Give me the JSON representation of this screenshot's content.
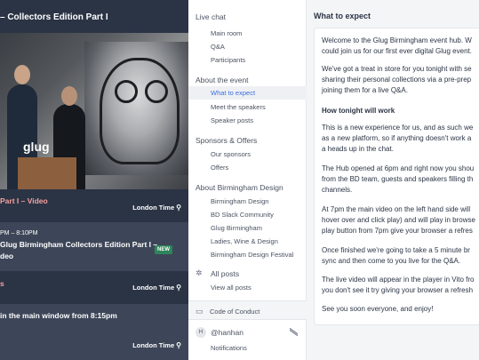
{
  "left": {
    "title": "– Collectors Edition Part I",
    "video_logo": "glug",
    "sessions": [
      {
        "title": "Part I – Video",
        "time": "London Time",
        "title_color": "#f4a0a0"
      },
      {
        "time_range": "PM – 8:10PM",
        "title_lines": [
          "Glug Birmingham Collectors Edition Part I –",
          "deo"
        ],
        "badge": "NEW",
        "time": "London Time"
      },
      {
        "title": "s",
        "time": "London Time",
        "title_color": "#f4a0a0"
      },
      {
        "title": "in the main window from 8:15pm",
        "time": "London Time"
      }
    ]
  },
  "nav": {
    "sections": [
      {
        "label": "Live chat",
        "items": [
          "Main room",
          "Q&A",
          "Participants"
        ]
      },
      {
        "label": "About the event",
        "items": [
          "What to expect",
          "Meet the speakers",
          "Speaker posts"
        ],
        "selected": 0
      },
      {
        "label": "Sponsors & Offers",
        "items": [
          "Our sponsors",
          "Offers"
        ]
      },
      {
        "label": "About Birmingham Design",
        "items": [
          "Birmingham Design",
          "BD Slack Community",
          "Glug Birmingham",
          "Ladies, Wine & Design",
          "Birmingham Design Festival"
        ]
      }
    ],
    "all_posts": "All posts",
    "view_all_posts": "View all posts",
    "code_of_conduct": "Code of Conduct",
    "user": {
      "initial": "H",
      "handle": "@hanhan"
    },
    "notifications": "Notifications",
    "accent": "#3c6ee0"
  },
  "right": {
    "header": "What to expect",
    "paragraphs": [
      {
        "lines": [
          "Welcome to the Glug Birmingham event hub. W",
          "could join us for our first ever digital Glug event."
        ]
      },
      {
        "lines": [
          "We've got a treat in store for you tonight with se",
          "sharing their personal collections via a pre-prep",
          "joining them for a live Q&A."
        ]
      },
      {
        "lines": [
          "How tonight will work"
        ],
        "bold": true
      },
      {
        "lines": [
          "This is a new experience for us, and as such we",
          "as a new platform, so if anything doesn't work a",
          "a heads up in the chat."
        ]
      },
      {
        "lines": [
          "The Hub opened at 6pm and right now you shou",
          "from the BD team, guests and speakers filling th",
          "channels."
        ]
      },
      {
        "lines": [
          "At 7pm the main video on the left hand side will",
          "hover over and click play) and will play in browse",
          "play button from 7pm give your browser a refres"
        ]
      },
      {
        "lines": [
          "Once finished we're going to take a 5 minute br",
          "sync and then come to you live for the Q&A."
        ]
      },
      {
        "lines": [
          "The live video will appear in the player in Vito fro",
          "you don't see it try giving your browser a refresh"
        ]
      },
      {
        "lines": [
          "See you soon everyone, and enjoy!"
        ]
      }
    ]
  }
}
